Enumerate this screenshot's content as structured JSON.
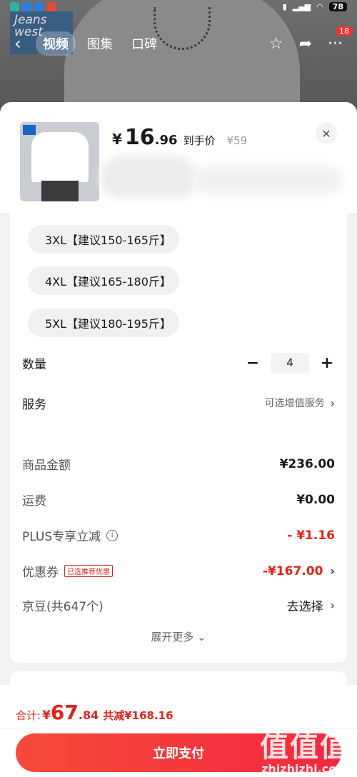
{
  "status_bar": {
    "battery": "78"
  },
  "brand_logo": {
    "line1": "Jeans",
    "line2": "west"
  },
  "top_nav": {
    "tabs": [
      {
        "label": "视频"
      },
      {
        "label": "图集"
      },
      {
        "label": "口碑"
      }
    ],
    "message_badge": "18"
  },
  "product": {
    "price_currency": "¥",
    "price_int": "16",
    "price_dec": ".96",
    "price_suffix": "到手价",
    "original_price": "¥59"
  },
  "sizes": [
    {
      "label": "3XL【建议150-165斤】"
    },
    {
      "label": "4XL【建议165-180斤】"
    },
    {
      "label": "5XL【建议180-195斤】"
    }
  ],
  "quantity": {
    "label": "数量",
    "value": "4",
    "minus": "−",
    "plus": "+"
  },
  "service": {
    "label": "服务",
    "value": "可选增值服务"
  },
  "summary": {
    "goods_amount_label": "商品金额",
    "goods_amount": "¥236.00",
    "shipping_label": "运费",
    "shipping": "¥0.00",
    "plus_label": "PLUS专享立减",
    "plus_value": "- ¥1.16",
    "coupon_label": "优惠券",
    "coupon_tag": "已选推荐优惠",
    "coupon_value": "-¥167.00",
    "jingdou_label": "京豆(共647个)",
    "jingdou_value": "去选择",
    "expand_label": "展开更多"
  },
  "footer": {
    "total_label": "合计:",
    "total_currency": "¥",
    "total_int": "67",
    "total_dec": ".84",
    "saved": "共减¥168.16",
    "pay_button": "立即支付"
  },
  "watermark": {
    "line1": "值值值",
    "line2": "zhizhizhi.com"
  },
  "colors": {
    "accent_red": "#e2231a",
    "pay_button": "#f3283f"
  }
}
